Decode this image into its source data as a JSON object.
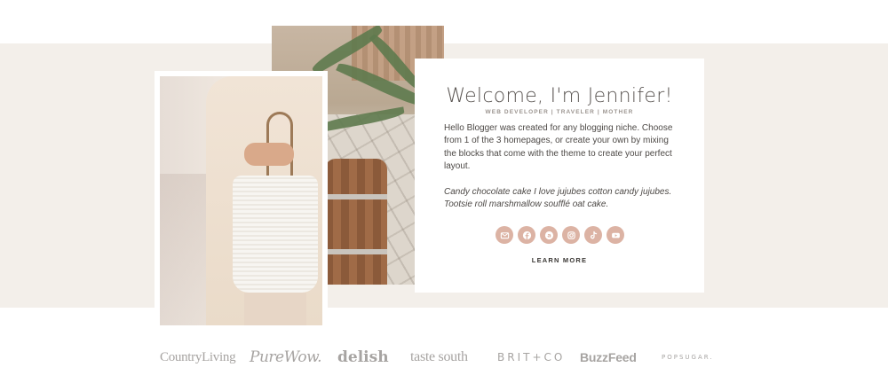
{
  "welcome": {
    "title": "Welcome, I'm Jennifer!",
    "tagline": "WEB DEVELOPER | TRAVELER | MOTHER",
    "bio": "Hello Blogger was created for any blogging niche. Choose from 1 of the 3 homepages, or create your own by mixing the blocks that come with the theme to create your perfect layout.",
    "quote": "Candy chocolate cake I love jujubes cotton candy jujubes. Tootsie roll marshmallow soufflé oat cake.",
    "cta_label": "LEARN MORE",
    "social_icons": [
      "email-icon",
      "facebook-icon",
      "amazon-icon",
      "instagram-icon",
      "tiktok-icon",
      "youtube-icon"
    ]
  },
  "press_logos": [
    {
      "name": "country-living",
      "text": "CountryLiving"
    },
    {
      "name": "purewow",
      "text": "PureWow."
    },
    {
      "name": "delish",
      "text": "delish"
    },
    {
      "name": "taste-of-the-south",
      "text": "taste south"
    },
    {
      "name": "brit-co",
      "text": "BRIT+CO"
    },
    {
      "name": "buzzfeed",
      "text": "BuzzFeed"
    },
    {
      "name": "popsugar",
      "text": "POPSUGAR."
    }
  ],
  "colors": {
    "band": "#f3efea",
    "accent": "#dcb3a4",
    "text": "#4d4946",
    "logo_grey": "#a7a4a2"
  }
}
